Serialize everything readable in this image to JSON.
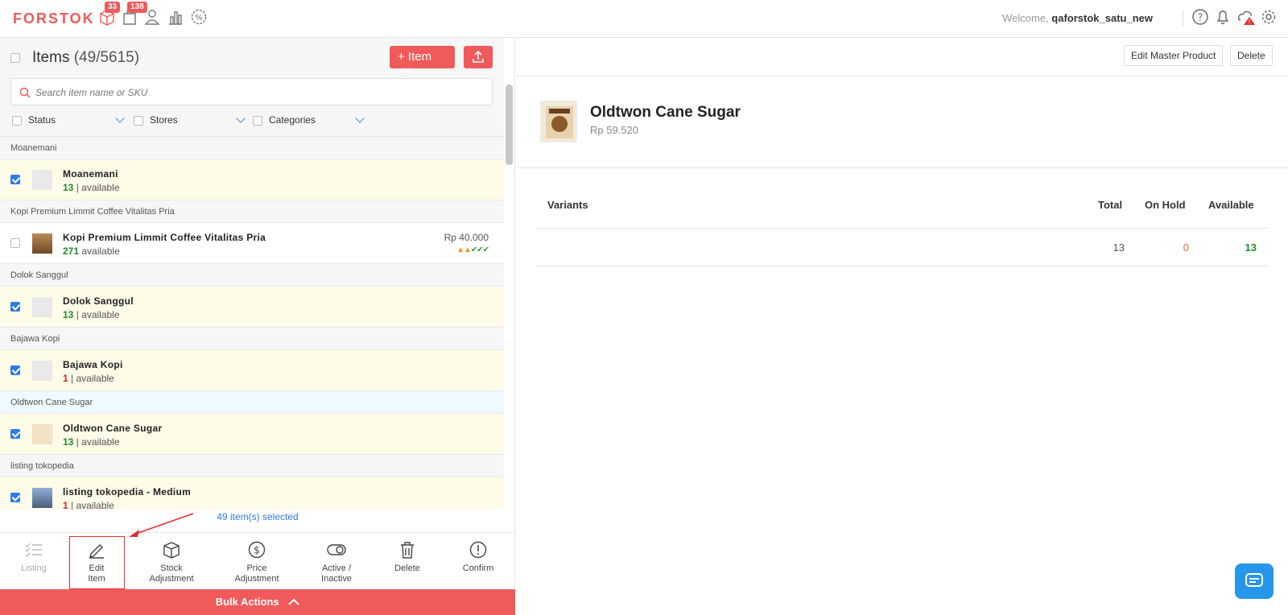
{
  "header": {
    "logo": "FORSTOK",
    "orders_badge": "33",
    "shipping_badge": "138",
    "welcome_prefix": "Welcome,",
    "username": "qaforstok_satu_new"
  },
  "items_panel": {
    "title": "Items",
    "count": "(49/5615)",
    "add_item_label": "+ Item",
    "search_placeholder": "Search item name or SKU",
    "filters": [
      "Status",
      "Stores",
      "Categories"
    ]
  },
  "groups": [
    {
      "header": "Moanemani",
      "name": "Moanemani",
      "qty": "13",
      "unit": "| available",
      "checked": true,
      "price": "",
      "qty_color": "green",
      "selected_header": false
    },
    {
      "header": "Kopi Premium Limmit Coffee Vitalitas Pria",
      "name": "Kopi Premium Limmit Coffee Vitalitas Pria",
      "qty": "271",
      "unit": "available",
      "checked": false,
      "price": "Rp 40.000",
      "qty_color": "green",
      "selected_header": false
    },
    {
      "header": "Dolok Sanggul",
      "name": "Dolok Sanggul",
      "qty": "13",
      "unit": "| available",
      "checked": true,
      "price": "",
      "qty_color": "green",
      "selected_header": false
    },
    {
      "header": "Bajawa Kopi",
      "name": "Bajawa Kopi",
      "qty": "1",
      "unit": "| available",
      "checked": true,
      "price": "",
      "qty_color": "red",
      "selected_header": false
    },
    {
      "header": "Oldtwon Cane Sugar",
      "name": "Oldtwon Cane Sugar",
      "qty": "13",
      "unit": "| available",
      "checked": true,
      "price": "",
      "qty_color": "green",
      "selected_header": true
    },
    {
      "header": "listing tokopedia",
      "name": "listing tokopedia - Medium",
      "qty": "1",
      "unit": "| available",
      "checked": true,
      "price": "",
      "qty_color": "red",
      "selected_header": false
    }
  ],
  "bulk": {
    "selected_text": "49 item(s) selected",
    "tools": [
      {
        "label1": "Listing",
        "label2": ""
      },
      {
        "label1": "Edit",
        "label2": "Item"
      },
      {
        "label1": "Stock",
        "label2": "Adjustment"
      },
      {
        "label1": "Price",
        "label2": "Adjustment"
      },
      {
        "label1": "Active /",
        "label2": "Inactive"
      },
      {
        "label1": "Delete",
        "label2": ""
      },
      {
        "label1": "Confirm",
        "label2": ""
      }
    ],
    "bar_label": "Bulk Actions"
  },
  "detail": {
    "edit_master_label": "Edit Master Product",
    "delete_label": "Delete",
    "product_name": "Oldtwon Cane Sugar",
    "product_price": "Rp 59.520",
    "table_headers": {
      "variants": "Variants",
      "total": "Total",
      "on_hold": "On Hold",
      "available": "Available"
    },
    "row": {
      "total": "13",
      "on_hold": "0",
      "available": "13"
    }
  },
  "colors": {
    "brand": "#f05a5a",
    "link": "#2d7be5",
    "green": "#1e8b2b",
    "red": "#d22222"
  }
}
